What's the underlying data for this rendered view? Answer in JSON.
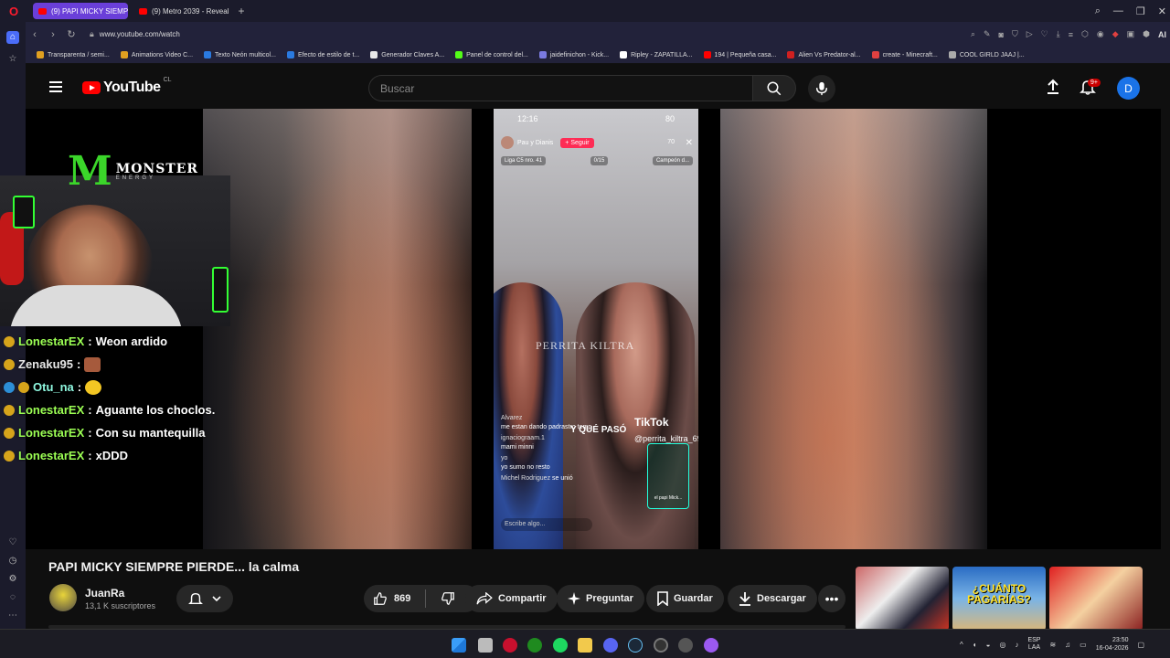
{
  "browser": {
    "logo": "O",
    "tabs": [
      {
        "label": "(9) PAPI MICKY SIEMPRE",
        "active": true
      },
      {
        "label": "(9) Metro 2039 - Reveal Tr",
        "active": false
      }
    ],
    "url": "www.youtube.com/watch",
    "ai_label": "AI",
    "bookmarks": [
      {
        "label": "Transparenta / semi...",
        "color": "#e0a020"
      },
      {
        "label": "Animations Video C...",
        "color": "#e0a020"
      },
      {
        "label": "Texto Neón multicol...",
        "color": "#2a7ae0"
      },
      {
        "label": "Efecto de estilo de t...",
        "color": "#2a7ae0"
      },
      {
        "label": "Generador Claves A...",
        "color": "#e8e8e8"
      },
      {
        "label": "Panel de control del...",
        "color": "#53fc18"
      },
      {
        "label": "jaidefinichon - Kick...",
        "color": "#7a7ae0"
      },
      {
        "label": "Ripley - ZAPATILLA...",
        "color": "#ffffff"
      },
      {
        "label": "194 | Pequeña casa...",
        "color": "#ff0000"
      },
      {
        "label": "Alien Vs Predator-al...",
        "color": "#d02020"
      },
      {
        "label": "create - Minecraft...",
        "color": "#e04040"
      },
      {
        "label": "COOL GIRLD JAAJ |...",
        "color": "#aaaaaa"
      }
    ]
  },
  "youtube": {
    "logo_text": "YouTube",
    "country_code": "CL",
    "search_placeholder": "Buscar",
    "notification_count": "9+",
    "avatar_letter": "D"
  },
  "video": {
    "phone_time": "12:16",
    "phone_battery": "80",
    "live_user": "Pau y Dianis",
    "follow_label": "+ Seguir",
    "viewer_count": "70",
    "tags": [
      "Liga C5 nro. 41",
      "0/15",
      "Campeón d..."
    ],
    "watermark": "PERRITA KILTRA",
    "que_paso": "Y QUÉ PASÓ",
    "tiktok_label": "TikTok",
    "tiktok_handle": "@perrita_kiltra_69",
    "comments": [
      {
        "user": "Alvarez",
        "text": "me estan dando padrastro temp"
      },
      {
        "user": "ignaciograam.1",
        "text": "mami minni"
      },
      {
        "user": "yo",
        "text": "yo sumo no resto"
      },
      {
        "user": "Michel Rodriguez",
        "text": "se unió"
      }
    ],
    "gift_label": "el papi Mick...",
    "input_placeholder": "Escribe algo...",
    "overlay": {
      "brand": "MONSTER",
      "brand_sub": "ENERGY"
    },
    "chat": [
      {
        "user": "LonestarEX",
        "message": "Weon ardido",
        "color": "green"
      },
      {
        "user": "Zenaku95",
        "message": "",
        "color": "white",
        "emote": "brick"
      },
      {
        "user": "Otu_na",
        "message": "",
        "color": "cyan",
        "emote": "face"
      },
      {
        "user": "LonestarEX",
        "message": "Aguante los choclos.",
        "color": "green"
      },
      {
        "user": "LonestarEX",
        "message": "Con su mantequilla",
        "color": "green"
      },
      {
        "user": "LonestarEX",
        "message": "xDDD",
        "color": "green"
      }
    ]
  },
  "meta": {
    "title": "PAPI MICKY SIEMPRE PIERDE... la calma",
    "channel": "JuanRa",
    "subscribers": "13,1 K suscriptores",
    "likes": "869",
    "share_label": "Compartir",
    "ask_label": "Preguntar",
    "save_label": "Guardar",
    "download_label": "Descargar",
    "more_label": "•••"
  },
  "recommendations": [
    {
      "overlay_text": ""
    },
    {
      "overlay_text": "¿CUÁNTO PAGARÍAS?"
    },
    {
      "overlay_text": ""
    }
  ],
  "taskbar": {
    "lang": "ESP",
    "lang_sub": "LAA",
    "time": "23:50",
    "date": "16-04-2026"
  },
  "colors": {
    "youtube_red": "#ff0000",
    "opera_purple": "#6a3fd9",
    "chat_green": "#9cff54"
  }
}
